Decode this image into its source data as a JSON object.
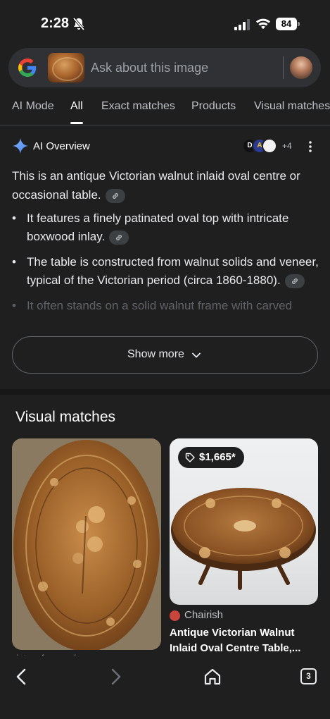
{
  "status_bar": {
    "time": "2:28",
    "battery": "84",
    "icons": [
      "bell-off-icon",
      "signal-icon",
      "wifi-icon",
      "battery-icon"
    ]
  },
  "search": {
    "placeholder": "Ask about this image",
    "icons": [
      "google-logo-icon",
      "query-image-thumbnail",
      "profile-avatar"
    ]
  },
  "tabs": [
    {
      "label": "AI Mode",
      "active": false
    },
    {
      "label": "All",
      "active": true
    },
    {
      "label": "Exact matches",
      "active": false
    },
    {
      "label": "Products",
      "active": false
    },
    {
      "label": "Visual matches",
      "active": false
    }
  ],
  "ai_overview": {
    "title": "AI Overview",
    "more_sources": "+4",
    "source_letters": [
      "D",
      "A",
      ""
    ],
    "intro": "This is an antique Victorian walnut inlaid oval centre or occasional table.",
    "bullets": [
      "It features a finely patinated oval top with intricate boxwood inlay.",
      "The table is constructed from walnut solids and veneer, typical of the Victorian period (circa 1860-1880).",
      "It often stands on a solid walnut frame with carved"
    ],
    "show_more": "Show more"
  },
  "visual_matches": {
    "title": "Visual matches",
    "cards": [
      {
        "source": "vintagefrance.shop",
        "price": "",
        "title": ""
      },
      {
        "source": "Chairish",
        "price": "$1,665*",
        "title": "Antique Victorian Walnut Inlaid Oval Centre Table,..."
      }
    ]
  },
  "bottom_nav": {
    "tab_count": "3",
    "icons": [
      "back-icon",
      "forward-icon",
      "home-icon",
      "tabs-icon"
    ]
  },
  "colors": {
    "background": "#1f1f1f",
    "search_bg": "#303134",
    "text_primary": "#e8eaed",
    "text_secondary": "#bdc1c6",
    "ai_sparkle": "#8ab4f8"
  }
}
